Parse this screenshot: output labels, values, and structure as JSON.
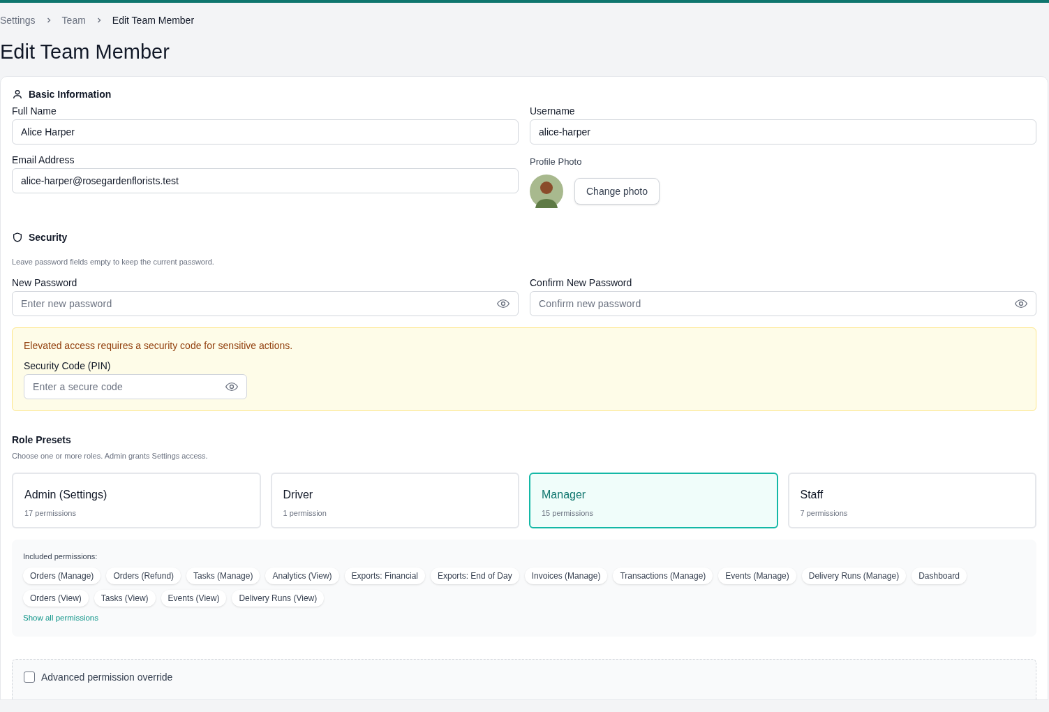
{
  "breadcrumb": [
    {
      "label": "Settings",
      "current": false
    },
    {
      "label": "Team",
      "current": false
    },
    {
      "label": "Edit Team Member",
      "current": true
    }
  ],
  "page_title": "Edit Team Member",
  "basic_information": {
    "title": "Basic Information",
    "full_name": {
      "label": "Full Name",
      "value": "Alice Harper"
    },
    "username": {
      "label": "Username",
      "value": "alice-harper"
    },
    "email": {
      "label": "Email Address",
      "value": "alice-harper@rosegardenflorists.test"
    },
    "profile_photo": {
      "label": "Profile Photo",
      "button": "Change photo"
    }
  },
  "security": {
    "title": "Security",
    "hint": "Leave password fields empty to keep the current password.",
    "new_password": {
      "label": "New Password",
      "placeholder": "Enter new password"
    },
    "confirm_password": {
      "label": "Confirm New Password",
      "placeholder": "Confirm new password"
    },
    "notice": {
      "message": "Elevated access requires a security code for sensitive actions.",
      "pin": {
        "label": "Security Code (PIN)",
        "placeholder": "Enter a secure code"
      }
    }
  },
  "role_presets": {
    "title": "Role Presets",
    "hint": "Choose one or more roles. Admin grants Settings access.",
    "roles": [
      {
        "name": "Admin (Settings)",
        "count": "17 permissions",
        "selected": false
      },
      {
        "name": "Driver",
        "count": "1 permission",
        "selected": false
      },
      {
        "name": "Manager",
        "count": "15 permissions",
        "selected": true
      },
      {
        "name": "Staff",
        "count": "7 permissions",
        "selected": false
      }
    ],
    "included": {
      "label": "Included permissions:",
      "permissions": [
        "Orders (Manage)",
        "Orders (Refund)",
        "Tasks (Manage)",
        "Analytics (View)",
        "Exports: Financial",
        "Exports: End of Day",
        "Invoices (Manage)",
        "Transactions (Manage)",
        "Events (Manage)",
        "Delivery Runs (Manage)",
        "Dashboard",
        "Orders (View)",
        "Tasks (View)",
        "Events (View)",
        "Delivery Runs (View)"
      ],
      "link": "Show all permissions"
    }
  },
  "advanced_override": {
    "label": "Advanced permission override",
    "checked": false
  }
}
